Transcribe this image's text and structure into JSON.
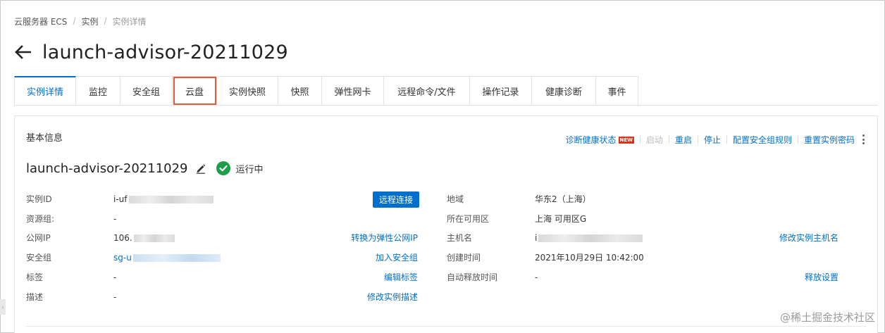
{
  "breadcrumb": {
    "items": [
      "云服务器 ECS",
      "实例",
      "实例详情"
    ]
  },
  "header": {
    "title": "launch-advisor-20211029"
  },
  "tabs": [
    {
      "label": "实例详情",
      "active": true
    },
    {
      "label": "监控"
    },
    {
      "label": "安全组"
    },
    {
      "label": "云盘",
      "highlighted": true
    },
    {
      "label": "实例快照"
    },
    {
      "label": "快照"
    },
    {
      "label": "弹性网卡"
    },
    {
      "label": "远程命令/文件"
    },
    {
      "label": "操作记录"
    },
    {
      "label": "健康诊断"
    },
    {
      "label": "事件"
    }
  ],
  "basic_info": {
    "section_title": "基本信息",
    "actions": {
      "diagnose": "诊断健康状态",
      "new_badge": "NEW",
      "start": "启动",
      "restart": "重启",
      "stop": "停止",
      "config_security_rules": "配置安全组规则",
      "reset_password": "重置实例密码"
    },
    "instance_name": "launch-advisor-20211029",
    "status": "运行中",
    "left": {
      "instance_id_label": "实例ID",
      "instance_id_value": "i-uf",
      "remote_connect_button": "远程连接",
      "resource_group_label": "资源组:",
      "resource_group_value": "-",
      "public_ip_label": "公网IP",
      "public_ip_value": "106.",
      "convert_eip_link": "转换为弹性公网IP",
      "security_group_label": "安全组",
      "security_group_value": "sg-u",
      "join_security_group_link": "加入安全组",
      "tags_label": "标签",
      "tags_value": "-",
      "edit_tags_link": "编辑标签",
      "description_label": "描述",
      "description_value": "-",
      "edit_description_link": "修改实例描述"
    },
    "right": {
      "region_label": "地域",
      "region_value": "华东2（上海）",
      "zone_label": "所在可用区",
      "zone_value": "上海 可用区G",
      "hostname_label": "主机名",
      "hostname_value": "i",
      "edit_hostname_link": "修改实例主机名",
      "created_label": "创建时间",
      "created_value": "2021年10月29日 10:42:00",
      "auto_release_label": "自动释放时间",
      "auto_release_value": "-",
      "release_settings_link": "释放设置"
    }
  },
  "watermark": "@稀土掘金技术社区",
  "colors": {
    "accent": "#0070cc",
    "highlight_box": "#e25a3c",
    "status_ok": "#1e9e4a",
    "new_badge": "#e0321a"
  }
}
